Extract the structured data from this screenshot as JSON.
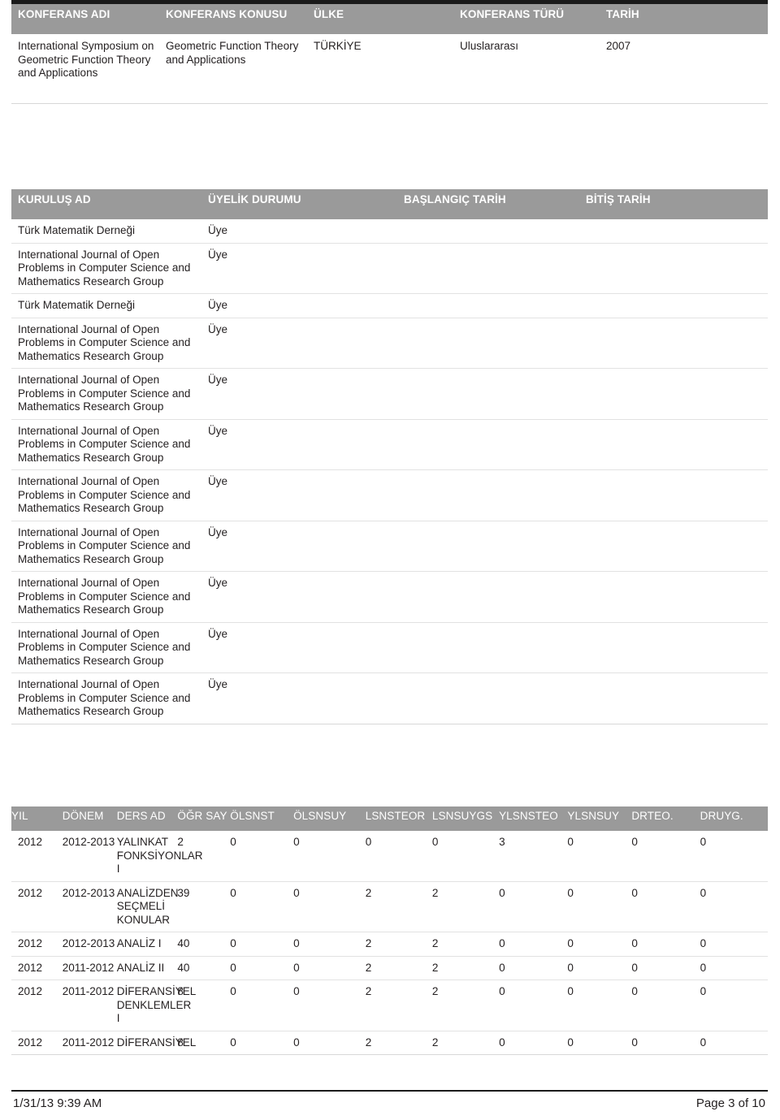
{
  "document": {
    "top_rule": "",
    "footer": {
      "timestamp": "1/31/13 9:39 AM",
      "page_label": "Page 3 of 10"
    }
  },
  "conference_table": {
    "headers": [
      "KONFERANS ADI",
      "KONFERANS KONUSU",
      "ÜLKE",
      "KONFERANS TÜRÜ",
      "TARİH"
    ],
    "rows": [
      {
        "name": "International Symposium on Geometric Function Theory and Applications",
        "topic": "Geometric Function Theory and Applications",
        "country": "TÜRKİYE",
        "type": "Uluslararası",
        "date": "2007"
      }
    ]
  },
  "membership_table": {
    "headers": [
      "KURULUŞ AD",
      "ÜYELİK DURUMU",
      "BAŞLANGIÇ TARİH",
      "BİTİŞ TARİH"
    ],
    "rows": [
      {
        "org": "Türk Matematik Derneği",
        "status": "Üye",
        "start": "",
        "end": ""
      },
      {
        "org": "International Journal of Open Problems in Computer Science and Mathematics Research Group",
        "status": "Üye",
        "start": "",
        "end": ""
      },
      {
        "org": "Türk Matematik Derneği",
        "status": "Üye",
        "start": "",
        "end": ""
      },
      {
        "org": "International Journal of Open Problems in Computer Science and Mathematics Research Group",
        "status": "Üye",
        "start": "",
        "end": ""
      },
      {
        "org": "International Journal of Open Problems in Computer Science and Mathematics Research Group",
        "status": "Üye",
        "start": "",
        "end": ""
      },
      {
        "org": "International Journal of Open Problems in Computer Science and Mathematics Research Group",
        "status": "Üye",
        "start": "",
        "end": ""
      },
      {
        "org": "International Journal of Open Problems in Computer Science and Mathematics Research Group",
        "status": "Üye",
        "start": "",
        "end": ""
      },
      {
        "org": "International Journal of Open Problems in Computer Science and Mathematics Research Group",
        "status": "Üye",
        "start": "",
        "end": ""
      },
      {
        "org": "International Journal of Open Problems in Computer Science and Mathematics Research Group",
        "status": "Üye",
        "start": "",
        "end": ""
      },
      {
        "org": "International Journal of Open Problems in Computer Science and Mathematics Research Group",
        "status": "Üye",
        "start": "",
        "end": ""
      },
      {
        "org": "International Journal of Open Problems in Computer Science and Mathematics Research Group",
        "status": "Üye",
        "start": "",
        "end": ""
      }
    ]
  },
  "course_table": {
    "headers": [
      "YIL",
      "DÖNEM",
      "DERS AD",
      "ÖĞR SAY",
      "ÖLSNST",
      "ÖLSNSUY",
      "LSNSTEOR",
      "LSNSUYGS",
      "YLSNSTEO",
      "YLSNSUY",
      "DRTEO.",
      "DRUYG."
    ],
    "rows": [
      {
        "yil": "2012",
        "donem": "2012-2013",
        "ders": "YALINKAT FONKSİYONLAR I",
        "ogr": "2",
        "olsnst": "0",
        "olsnsuy": "0",
        "lsnsteor": "0",
        "lsnsuygs": "0",
        "ylsnsteo": "3",
        "ylsnsuy": "0",
        "drteo": "0",
        "druyg": "0"
      },
      {
        "yil": "2012",
        "donem": "2012-2013",
        "ders": "ANALİZDEN SEÇMELİ KONULAR",
        "ogr": "39",
        "olsnst": "0",
        "olsnsuy": "0",
        "lsnsteor": "2",
        "lsnsuygs": "2",
        "ylsnsteo": "0",
        "ylsnsuy": "0",
        "drteo": "0",
        "druyg": "0"
      },
      {
        "yil": "2012",
        "donem": "2012-2013",
        "ders": "ANALİZ I",
        "ogr": "40",
        "olsnst": "0",
        "olsnsuy": "0",
        "lsnsteor": "2",
        "lsnsuygs": "2",
        "ylsnsteo": "0",
        "ylsnsuy": "0",
        "drteo": "0",
        "druyg": "0"
      },
      {
        "yil": "2012",
        "donem": "2011-2012",
        "ders": "ANALİZ II",
        "ogr": "40",
        "olsnst": "0",
        "olsnsuy": "0",
        "lsnsteor": "2",
        "lsnsuygs": "2",
        "ylsnsteo": "0",
        "ylsnsuy": "0",
        "drteo": "0",
        "druyg": "0"
      },
      {
        "yil": "2012",
        "donem": "2011-2012",
        "ders": "DİFERANSİYEL DENKLEMLER I",
        "ogr": "8",
        "olsnst": "0",
        "olsnsuy": "0",
        "lsnsteor": "2",
        "lsnsuygs": "2",
        "ylsnsteo": "0",
        "ylsnsuy": "0",
        "drteo": "0",
        "druyg": "0"
      },
      {
        "yil": "2012",
        "donem": "2011-2012",
        "ders": "DİFERANSİYEL",
        "ogr": "8",
        "olsnst": "0",
        "olsnsuy": "0",
        "lsnsteor": "2",
        "lsnsuygs": "2",
        "ylsnsteo": "0",
        "ylsnsuy": "0",
        "drteo": "0",
        "druyg": "0"
      }
    ]
  }
}
